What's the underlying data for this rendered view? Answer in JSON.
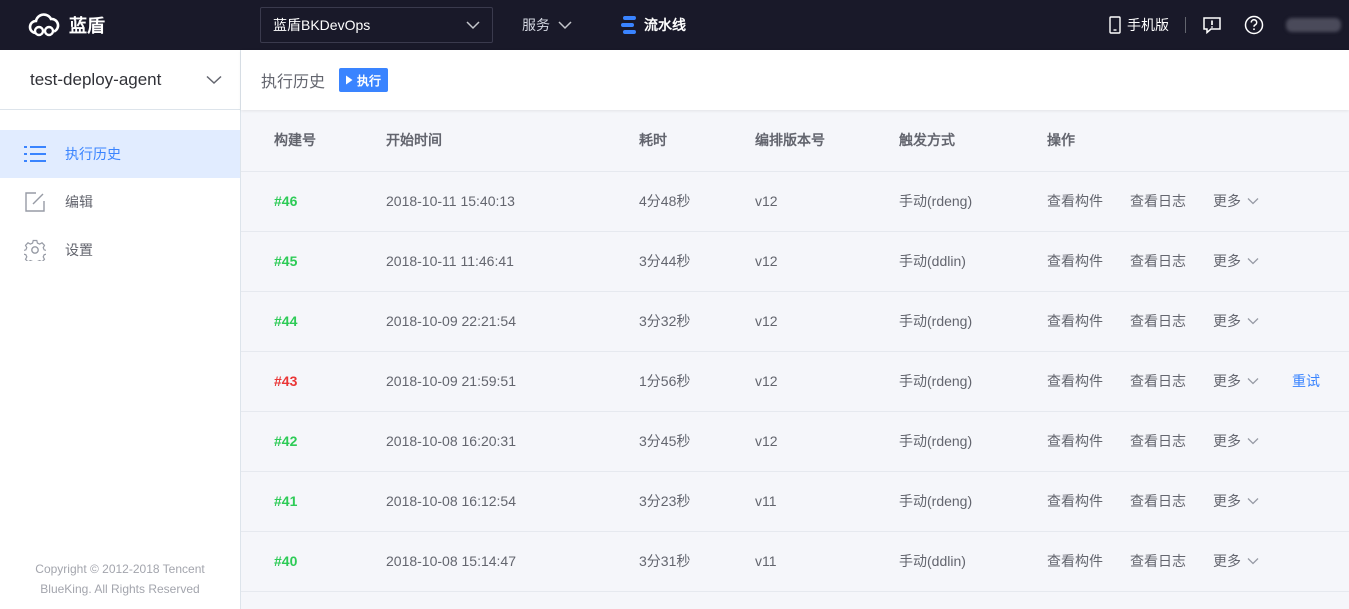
{
  "topbar": {
    "brand": "蓝盾",
    "project": "蓝盾BKDevOps",
    "nav_service": "服务",
    "nav_pipeline": "流水线",
    "mobile": "手机版"
  },
  "sidebar": {
    "pipeline_name": "test-deploy-agent",
    "items": [
      {
        "label": "执行历史",
        "icon": "list-icon"
      },
      {
        "label": "编辑",
        "icon": "edit-icon"
      },
      {
        "label": "设置",
        "icon": "gear-icon"
      }
    ],
    "copyright_line1": "Copyright © 2012-2018 Tencent",
    "copyright_line2": "BlueKing. All Rights Reserved"
  },
  "main": {
    "title": "执行历史",
    "exec_button": "执行"
  },
  "table": {
    "headers": {
      "build": "构建号",
      "start": "开始时间",
      "duration": "耗时",
      "version": "编排版本号",
      "trigger": "触发方式",
      "ops": "操作"
    },
    "ops_labels": {
      "artifacts": "查看构件",
      "logs": "查看日志",
      "more": "更多",
      "retry": "重试"
    },
    "rows": [
      {
        "build": "#46",
        "status": "success",
        "start": "2018-10-11 15:40:13",
        "duration": "4分48秒",
        "version": "v12",
        "trigger": "手动(rdeng)"
      },
      {
        "build": "#45",
        "status": "success",
        "start": "2018-10-11 11:46:41",
        "duration": "3分44秒",
        "version": "v12",
        "trigger": "手动(ddlin)"
      },
      {
        "build": "#44",
        "status": "success",
        "start": "2018-10-09 22:21:54",
        "duration": "3分32秒",
        "version": "v12",
        "trigger": "手动(rdeng)"
      },
      {
        "build": "#43",
        "status": "failed",
        "start": "2018-10-09 21:59:51",
        "duration": "1分56秒",
        "version": "v12",
        "trigger": "手动(rdeng)"
      },
      {
        "build": "#42",
        "status": "success",
        "start": "2018-10-08 16:20:31",
        "duration": "3分45秒",
        "version": "v12",
        "trigger": "手动(rdeng)"
      },
      {
        "build": "#41",
        "status": "success",
        "start": "2018-10-08 16:12:54",
        "duration": "3分23秒",
        "version": "v11",
        "trigger": "手动(rdeng)"
      },
      {
        "build": "#40",
        "status": "success",
        "start": "2018-10-08 15:14:47",
        "duration": "3分31秒",
        "version": "v11",
        "trigger": "手动(ddlin)"
      }
    ]
  },
  "colors": {
    "topbar_bg": "#191929",
    "accent": "#3a84ff",
    "success": "#2dcb56",
    "failed": "#ea3636"
  }
}
